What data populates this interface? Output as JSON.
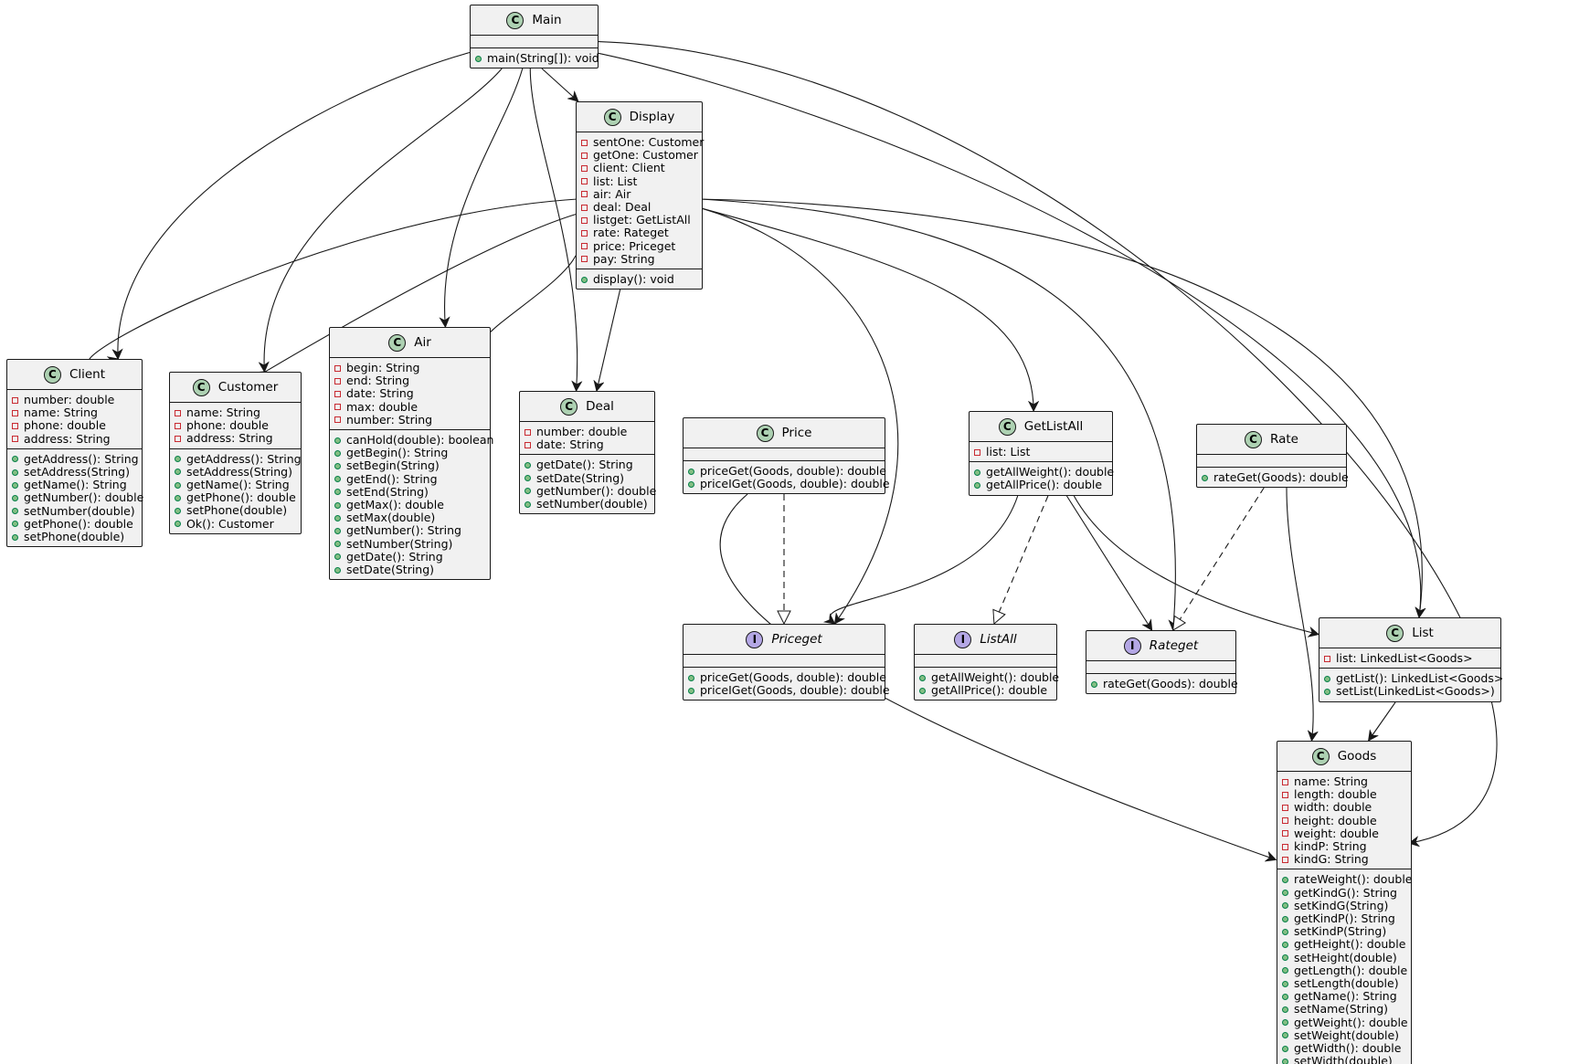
{
  "diagram": {
    "classes": [
      {
        "id": "Main",
        "name": "Main",
        "kind": "class",
        "fields": [],
        "methods": [
          "main(String[]): void"
        ]
      },
      {
        "id": "Display",
        "name": "Display",
        "kind": "class",
        "fields": [
          "sentOne: Customer",
          "getOne: Customer",
          "client: Client",
          "list: List",
          "air: Air",
          "deal: Deal",
          "listget: GetListAll",
          "rate: Rateget",
          "price: Priceget",
          "pay: String"
        ],
        "methods": [
          "display(): void"
        ]
      },
      {
        "id": "Client",
        "name": "Client",
        "kind": "class",
        "fields": [
          "number: double",
          "name: String",
          "phone: double",
          "address: String"
        ],
        "methods": [
          "getAddress(): String",
          "setAddress(String)",
          "getName(): String",
          "getNumber(): double",
          "setNumber(double)",
          "getPhone(): double",
          "setPhone(double)"
        ]
      },
      {
        "id": "Customer",
        "name": "Customer",
        "kind": "class",
        "fields": [
          "name: String",
          "phone: double",
          "address: String"
        ],
        "methods": [
          "getAddress(): String",
          "setAddress(String)",
          "getName(): String",
          "getPhone(): double",
          "setPhone(double)",
          "Ok(): Customer"
        ]
      },
      {
        "id": "Air",
        "name": "Air",
        "kind": "class",
        "fields": [
          "begin: String",
          "end: String",
          "date: String",
          "max: double",
          "number: String"
        ],
        "methods": [
          "canHold(double): boolean",
          "getBegin(): String",
          "setBegin(String)",
          "getEnd(): String",
          "setEnd(String)",
          "getMax(): double",
          "setMax(double)",
          "getNumber(): String",
          "setNumber(String)",
          "getDate(): String",
          "setDate(String)"
        ]
      },
      {
        "id": "Deal",
        "name": "Deal",
        "kind": "class",
        "fields": [
          "number: double",
          "date: String"
        ],
        "methods": [
          "getDate(): String",
          "setDate(String)",
          "getNumber(): double",
          "setNumber(double)"
        ]
      },
      {
        "id": "Price",
        "name": "Price",
        "kind": "class",
        "fields": [],
        "methods": [
          "priceGet(Goods, double): double",
          "priceIGet(Goods, double): double"
        ]
      },
      {
        "id": "GetListAll",
        "name": "GetListAll",
        "kind": "class",
        "fields": [
          "list: List"
        ],
        "methods": [
          "getAllWeight(): double",
          "getAllPrice(): double"
        ]
      },
      {
        "id": "Rate",
        "name": "Rate",
        "kind": "class",
        "fields": [],
        "methods": [
          "rateGet(Goods): double"
        ]
      },
      {
        "id": "Priceget",
        "name": "Priceget",
        "kind": "interface",
        "fields": [],
        "methods": [
          "priceGet(Goods, double): double",
          "priceIGet(Goods, double): double"
        ]
      },
      {
        "id": "ListAll",
        "name": "ListAll",
        "kind": "interface",
        "fields": [],
        "methods": [
          "getAllWeight(): double",
          "getAllPrice(): double"
        ]
      },
      {
        "id": "Rateget",
        "name": "Rateget",
        "kind": "interface",
        "fields": [],
        "methods": [
          "rateGet(Goods): double"
        ]
      },
      {
        "id": "List",
        "name": "List",
        "kind": "class",
        "fields": [
          "list: LinkedList<Goods>"
        ],
        "methods": [
          "getList(): LinkedList<Goods>",
          "setList(LinkedList<Goods>)"
        ]
      },
      {
        "id": "Goods",
        "name": "Goods",
        "kind": "class",
        "fields": [
          "name: String",
          "length: double",
          "width: double",
          "height: double",
          "weight: double",
          "kindP: String",
          "kindG: String"
        ],
        "methods": [
          "rateWeight(): double",
          "getKindG(): String",
          "setKindG(String)",
          "getKindP(): String",
          "setKindP(String)",
          "getHeight(): double",
          "setHeight(double)",
          "getLength(): double",
          "setLength(double)",
          "getName(): String",
          "setName(String)",
          "getWeight(): double",
          "setWeight(double)",
          "getWidth(): double",
          "setWidth(double)"
        ]
      }
    ],
    "relations": [
      {
        "from": "Main",
        "to": "Display",
        "type": "association"
      },
      {
        "from": "Main",
        "to": "Client",
        "type": "association"
      },
      {
        "from": "Main",
        "to": "Customer",
        "type": "association"
      },
      {
        "from": "Main",
        "to": "Air",
        "type": "association"
      },
      {
        "from": "Main",
        "to": "Deal",
        "type": "association"
      },
      {
        "from": "Main",
        "to": "List",
        "type": "association"
      },
      {
        "from": "Main",
        "to": "Goods",
        "type": "association"
      },
      {
        "from": "Display",
        "to": "Client",
        "type": "association"
      },
      {
        "from": "Display",
        "to": "Customer",
        "type": "association"
      },
      {
        "from": "Display",
        "to": "Air",
        "type": "association"
      },
      {
        "from": "Display",
        "to": "Deal",
        "type": "association"
      },
      {
        "from": "Display",
        "to": "Priceget",
        "type": "association"
      },
      {
        "from": "Display",
        "to": "GetListAll",
        "type": "association"
      },
      {
        "from": "Display",
        "to": "Rateget",
        "type": "association"
      },
      {
        "from": "Display",
        "to": "List",
        "type": "association"
      },
      {
        "from": "Price",
        "to": "Priceget",
        "type": "realization"
      },
      {
        "from": "Price",
        "to": "Goods",
        "type": "association"
      },
      {
        "from": "GetListAll",
        "to": "Priceget",
        "type": "association"
      },
      {
        "from": "GetListAll",
        "to": "ListAll",
        "type": "realization"
      },
      {
        "from": "GetListAll",
        "to": "Rateget",
        "type": "association"
      },
      {
        "from": "GetListAll",
        "to": "List",
        "type": "association"
      },
      {
        "from": "Rate",
        "to": "Rateget",
        "type": "realization"
      },
      {
        "from": "Rate",
        "to": "Goods",
        "type": "association"
      },
      {
        "from": "List",
        "to": "Goods",
        "type": "association"
      }
    ]
  }
}
